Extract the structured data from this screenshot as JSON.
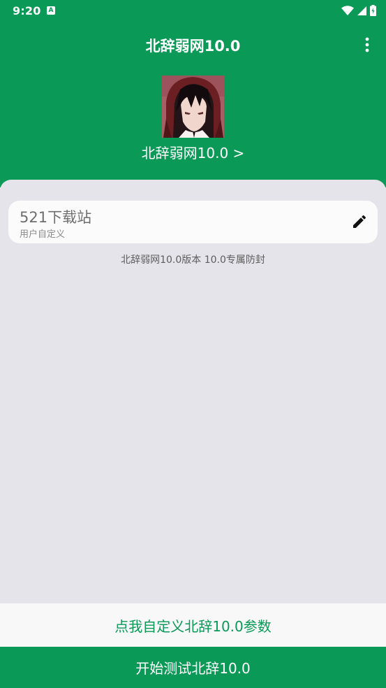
{
  "status_bar": {
    "time": "9:20",
    "app_icon_letter": "A",
    "icons": [
      "wifi-icon",
      "signal-icon",
      "battery-icon"
    ]
  },
  "toolbar": {
    "title": "北辞弱网10.0",
    "menu_icon": "more-vert-icon"
  },
  "profile": {
    "avatar": "anime-character-avatar",
    "name": "北辞弱网10.0 >"
  },
  "config_card": {
    "title": "521下载站",
    "subtitle": "用户自定义",
    "edit_icon": "pencil-icon"
  },
  "version_info": "北辞弱网10.0版本 10.0专属防封",
  "buttons": {
    "custom_params": "点我自定义北辞10.0参数",
    "start_test": "开始测试北辞10.0"
  },
  "colors": {
    "brand_green": "#0a9956",
    "background": "#e5e4ea",
    "card": "#fbfbfc",
    "white": "#ffffff"
  }
}
